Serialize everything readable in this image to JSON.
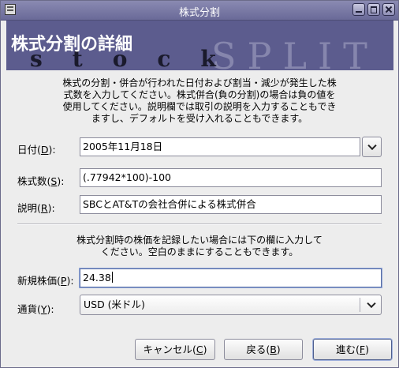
{
  "window": {
    "title": "株式分割",
    "icon": "app-menu-icon"
  },
  "banner": {
    "title": "株式分割の詳細",
    "bg_text": "SPLIT",
    "stock_text": "stock"
  },
  "description": [
    "株式の分割・併合が行われた日付および割当・減少が発生した株",
    "式数を入力してください。株式併合(負の分割)の場合は負の値を",
    "使用してください。説明欄では取引の説明を入力することもでき",
    "ますし、デフォルトを受け入れることもできます。"
  ],
  "fields": {
    "date": {
      "label": "日付(",
      "mnemonic": "D",
      "label_end": "):",
      "value": "2005年11月18日"
    },
    "shares": {
      "label": "株式数(",
      "mnemonic": "S",
      "label_end": "):",
      "value": "(.77942*100)-100"
    },
    "memo": {
      "label": "説明(",
      "mnemonic": "R",
      "label_end": "):",
      "value": "SBCとAT&Tの会社合併による株式併合"
    }
  },
  "price_description": [
    "株式分割時の株価を記録したい場合には下の欄に入力して",
    "ください。空白のままにすることもできます。"
  ],
  "price": {
    "label": "新規株価(",
    "mnemonic": "P",
    "label_end": "):",
    "value": "24.38"
  },
  "currency": {
    "label": "通貨(",
    "mnemonic": "Y",
    "label_end": "):",
    "selected": "USD (米ドル)"
  },
  "buttons": {
    "cancel": {
      "label": "キャンセル(",
      "mnemonic": "C",
      "label_end": ")"
    },
    "back": {
      "label": "戻る(",
      "mnemonic": "B",
      "label_end": ")"
    },
    "forward": {
      "label": "進む(",
      "mnemonic": "F",
      "label_end": ")"
    }
  }
}
